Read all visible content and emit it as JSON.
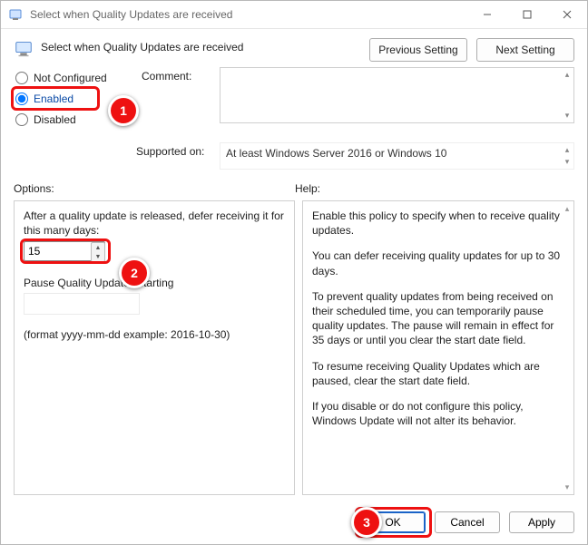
{
  "titlebar": {
    "title": "Select when Quality Updates are received"
  },
  "header": {
    "title": "Select when Quality Updates are received",
    "previous_setting": "Previous Setting",
    "next_setting": "Next Setting"
  },
  "state": {
    "not_configured": "Not Configured",
    "enabled": "Enabled",
    "disabled": "Disabled",
    "selected": "enabled"
  },
  "labels": {
    "comment": "Comment:",
    "supported_on": "Supported on:",
    "options": "Options:",
    "help": "Help:"
  },
  "supported_on_text": "At least Windows Server 2016 or Windows 10",
  "options": {
    "defer_label": "After a quality update is released, defer receiving it for this many days:",
    "defer_days": "15",
    "pause_label": "Pause Quality Updates starting",
    "pause_value": "",
    "format_hint": "(format yyyy-mm-dd example: 2016-10-30)"
  },
  "help_paragraphs": [
    "Enable this policy to specify when to receive quality updates.",
    "You can defer receiving quality updates for up to 30 days.",
    "To prevent quality updates from being received on their scheduled time, you can temporarily pause quality updates. The pause will remain in effect for 35 days or until you clear the start date field.",
    "To resume receiving Quality Updates which are paused, clear the start date field.",
    "If you disable or do not configure this policy, Windows Update will not alter its behavior."
  ],
  "footer": {
    "ok": "OK",
    "cancel": "Cancel",
    "apply": "Apply"
  },
  "annotations": {
    "c1": "1",
    "c2": "2",
    "c3": "3"
  }
}
